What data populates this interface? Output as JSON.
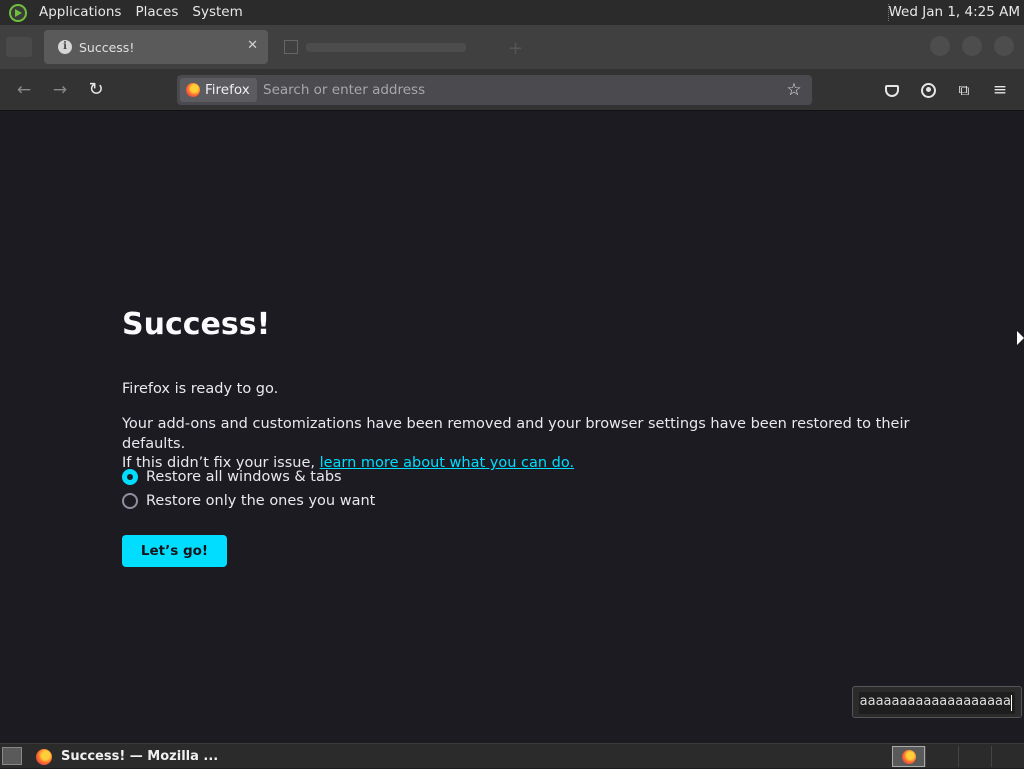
{
  "system_panel": {
    "menus": [
      "Applications",
      "Places",
      "System"
    ],
    "clock": "Wed Jan  1,  4:25 AM"
  },
  "browser": {
    "active_tab": {
      "title": "Success!",
      "icon": "info-icon",
      "close": "✕"
    },
    "inactive_tab": {
      "icon": "flag-icon"
    },
    "nav": {
      "back_icon": "←",
      "forward_icon": "→",
      "reload_icon": "↻",
      "identity_label": "Firefox",
      "url_placeholder": "Search or enter address",
      "star_icon": "☆",
      "menu_icon": "≡"
    }
  },
  "page": {
    "heading": "Success!",
    "ready_text": "Firefox is ready to go.",
    "description_line1": "Your add-ons and customizations have been removed and your browser settings have been restored to their defaults.",
    "description_line2_prefix": "If this didn’t fix your issue, ",
    "learn_link": "learn more about what you can do.",
    "restore_options": [
      {
        "label": "Restore all windows & tabs",
        "checked": true
      },
      {
        "label": "Restore only the ones you want",
        "checked": false
      }
    ],
    "go_button": "Let’s go!",
    "accent_color": "#00ddff"
  },
  "floating_field": {
    "value": "aaaaaaaaaaaaaaaaaaaaaaa"
  },
  "taskbar": {
    "task_label": "Success! — Mozilla ..."
  }
}
